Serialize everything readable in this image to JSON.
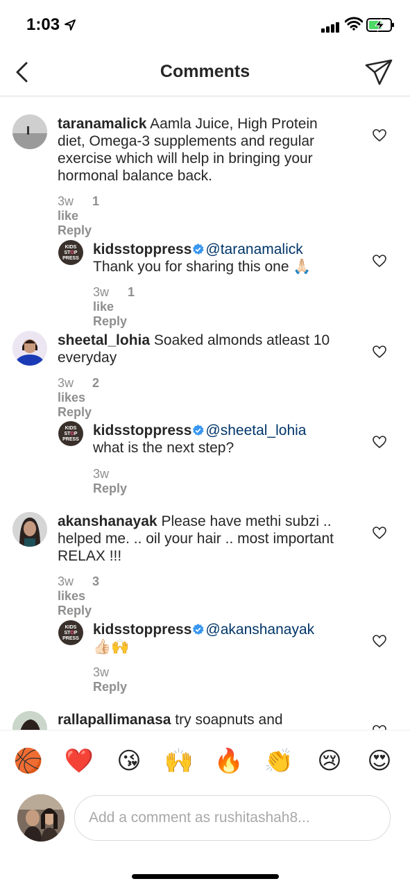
{
  "status_bar": {
    "time": "1:03"
  },
  "header": {
    "title": "Comments"
  },
  "comments": [
    {
      "kind": "top",
      "username": "taranamalick",
      "text": "Aamla Juice, High Protein diet, Omega-3 supplements and regular exercise which will help in bringing your hormonal balance back.",
      "time": "3w",
      "likes": "1 like",
      "reply": "Reply"
    },
    {
      "kind": "reply",
      "username": "kidsstoppress",
      "mention": "@taranamalick",
      "text": "Thank you for sharing this one 🙏🏻",
      "time": "3w",
      "likes": "1 like",
      "reply": "Reply"
    },
    {
      "kind": "top",
      "username": "sheetal_lohia",
      "text": "Soaked almonds atleast 10 everyday",
      "time": "3w",
      "likes": "2 likes",
      "reply": "Reply"
    },
    {
      "kind": "reply",
      "username": "kidsstoppress",
      "mention": "@sheetal_lohia",
      "text": "what is the next step?",
      "time": "3w",
      "reply": "Reply"
    },
    {
      "kind": "top",
      "username": "akanshanayak",
      "text": "Please have methi subzi .. helped me. .. oil your hair .. most important RELAX !!!",
      "time": "3w",
      "likes": "3 likes",
      "reply": "Reply"
    },
    {
      "kind": "reply",
      "username": "kidsstoppress",
      "mention": "@akanshanayak",
      "text": "👍🏻🙌",
      "time": "3w",
      "reply": "Reply"
    },
    {
      "kind": "top",
      "username": "rallapallimanasa",
      "text": "try soapnuts and"
    }
  ],
  "brand_avatar": {
    "line1": "KIDS",
    "line2a": "ST",
    "line2b": "O",
    "line2c": "P",
    "line3": "PRESS"
  },
  "emoji_bar": [
    "🏀",
    "❤️",
    "😘",
    "🙌",
    "🔥",
    "👏",
    "😢",
    "😍"
  ],
  "composer": {
    "placeholder": "Add a comment as rushitashah8..."
  },
  "colors": {
    "mention": "#003569",
    "verified": "#3897f0",
    "meta": "#8e8e8e",
    "battery": "#4cd964"
  }
}
